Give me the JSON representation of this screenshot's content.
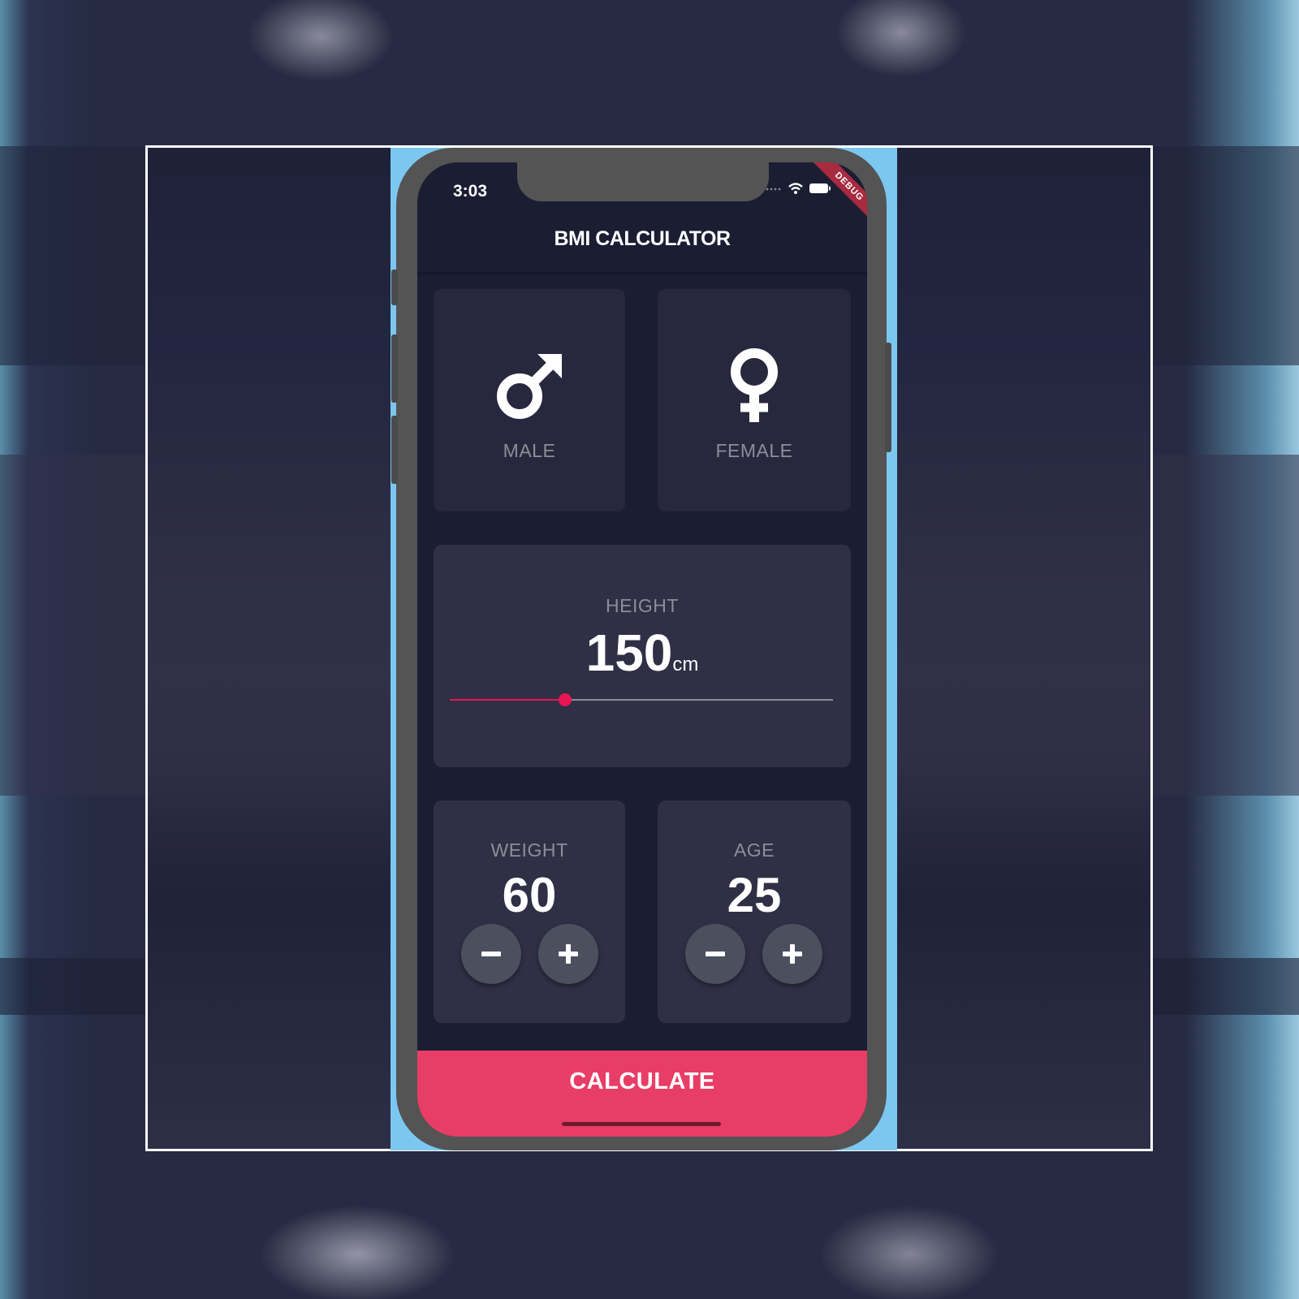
{
  "status_bar": {
    "time": "3:03",
    "debug_label": "DEBUG"
  },
  "app_bar": {
    "title": "BMI CALCULATOR"
  },
  "gender": {
    "male_label": "MALE",
    "female_label": "FEMALE",
    "male_icon": "mars-icon",
    "female_icon": "venus-icon"
  },
  "height": {
    "label": "HEIGHT",
    "value": "150",
    "unit": "cm",
    "slider_fraction": 0.3
  },
  "weight": {
    "label": "WEIGHT",
    "value": "60"
  },
  "age": {
    "label": "AGE",
    "value": "25"
  },
  "calculate_button": {
    "label": "CALCULATE"
  },
  "colors": {
    "background": "#1b1d33",
    "card": "#2f2f46",
    "accent": "#eb1555",
    "bottom_button": "#e83d66",
    "label_grey": "#8d8e98",
    "round_button": "#4c4f5e"
  }
}
